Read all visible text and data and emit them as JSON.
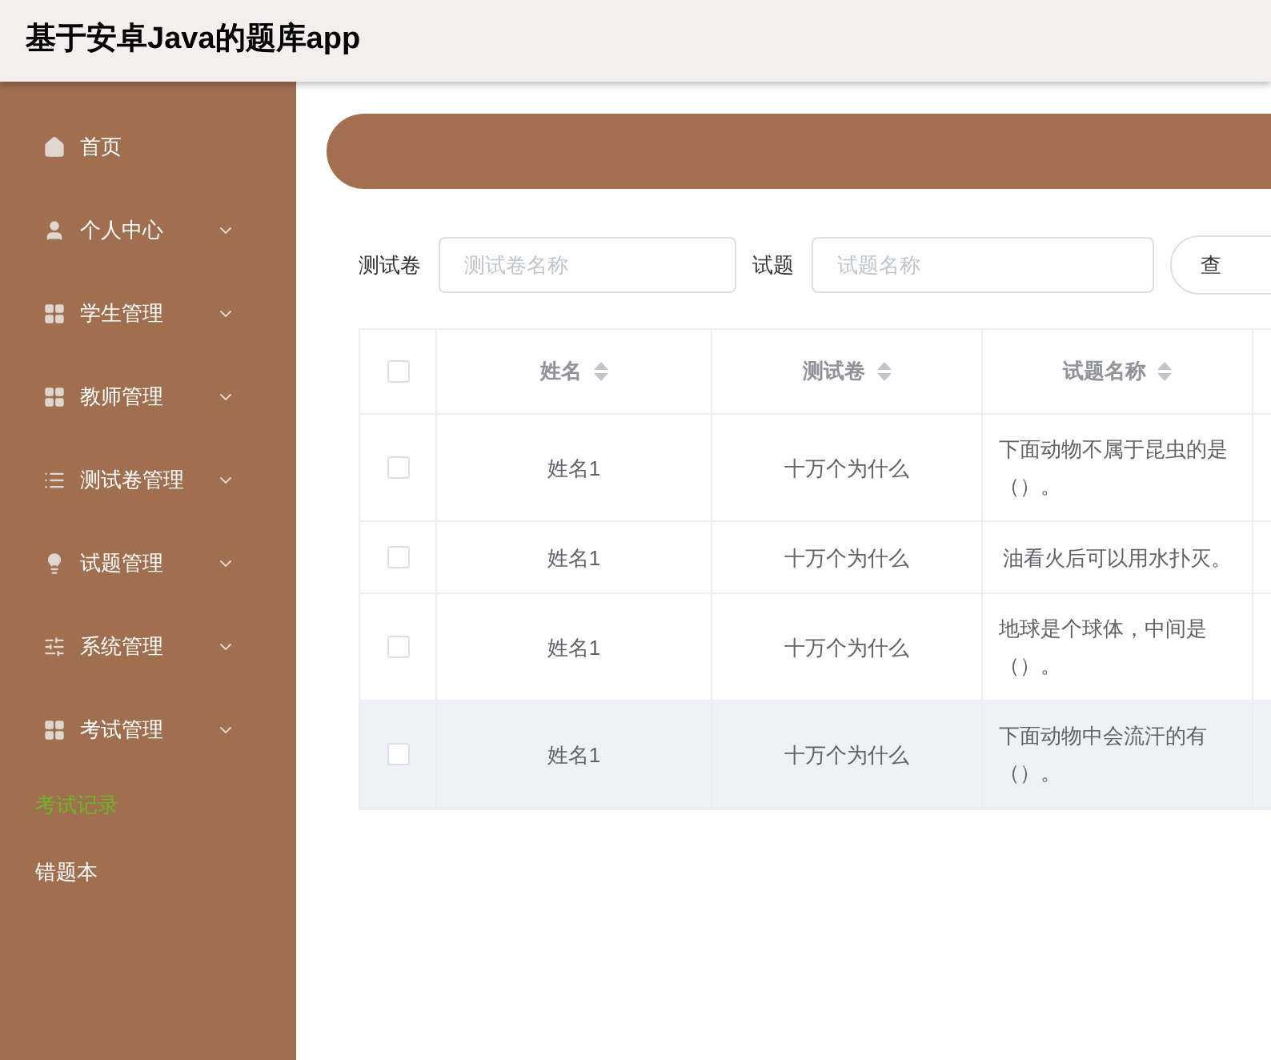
{
  "header": {
    "title": "基于安卓Java的题库app"
  },
  "sidebar": {
    "items": [
      {
        "kind": "menu",
        "label": "首页",
        "expandable": false,
        "selected": false
      },
      {
        "kind": "menu",
        "label": "个人中心",
        "expandable": true,
        "selected": false
      },
      {
        "kind": "menu",
        "label": "学生管理",
        "expandable": true,
        "selected": false
      },
      {
        "kind": "menu",
        "label": "教师管理",
        "expandable": true,
        "selected": false
      },
      {
        "kind": "menu",
        "label": "测试卷管理",
        "expandable": true,
        "selected": false
      },
      {
        "kind": "menu",
        "label": "试题管理",
        "expandable": true,
        "selected": false
      },
      {
        "kind": "menu",
        "label": "系统管理",
        "expandable": true,
        "selected": false
      },
      {
        "kind": "menu",
        "label": "考试管理",
        "expandable": true,
        "selected": false
      },
      {
        "kind": "link",
        "label": "考试记录",
        "selected": true
      },
      {
        "kind": "link",
        "label": "错题本",
        "selected": false
      }
    ]
  },
  "search": {
    "fields": [
      {
        "label": "测试卷",
        "placeholder": "测试卷名称"
      },
      {
        "label": "试题",
        "placeholder": "试题名称"
      }
    ],
    "button": "查"
  },
  "table": {
    "all_checked": false,
    "columns": [
      "姓名",
      "测试卷",
      "试题名称"
    ],
    "rows": [
      {
        "checked": false,
        "highlighted": false,
        "cells": [
          "姓名1",
          "十万个为什么",
          "下面动物不属于昆虫的是（）。"
        ]
      },
      {
        "checked": false,
        "highlighted": false,
        "cells": [
          "姓名1",
          "十万个为什么",
          "油看火后可以用水扑灭。"
        ]
      },
      {
        "checked": false,
        "highlighted": false,
        "cells": [
          "姓名1",
          "十万个为什么",
          "地球是个球体，中间是（）。"
        ]
      },
      {
        "checked": false,
        "highlighted": true,
        "cells": [
          "姓名1",
          "十万个为什么",
          "下面动物中会流汗的有（）。"
        ]
      }
    ]
  }
}
